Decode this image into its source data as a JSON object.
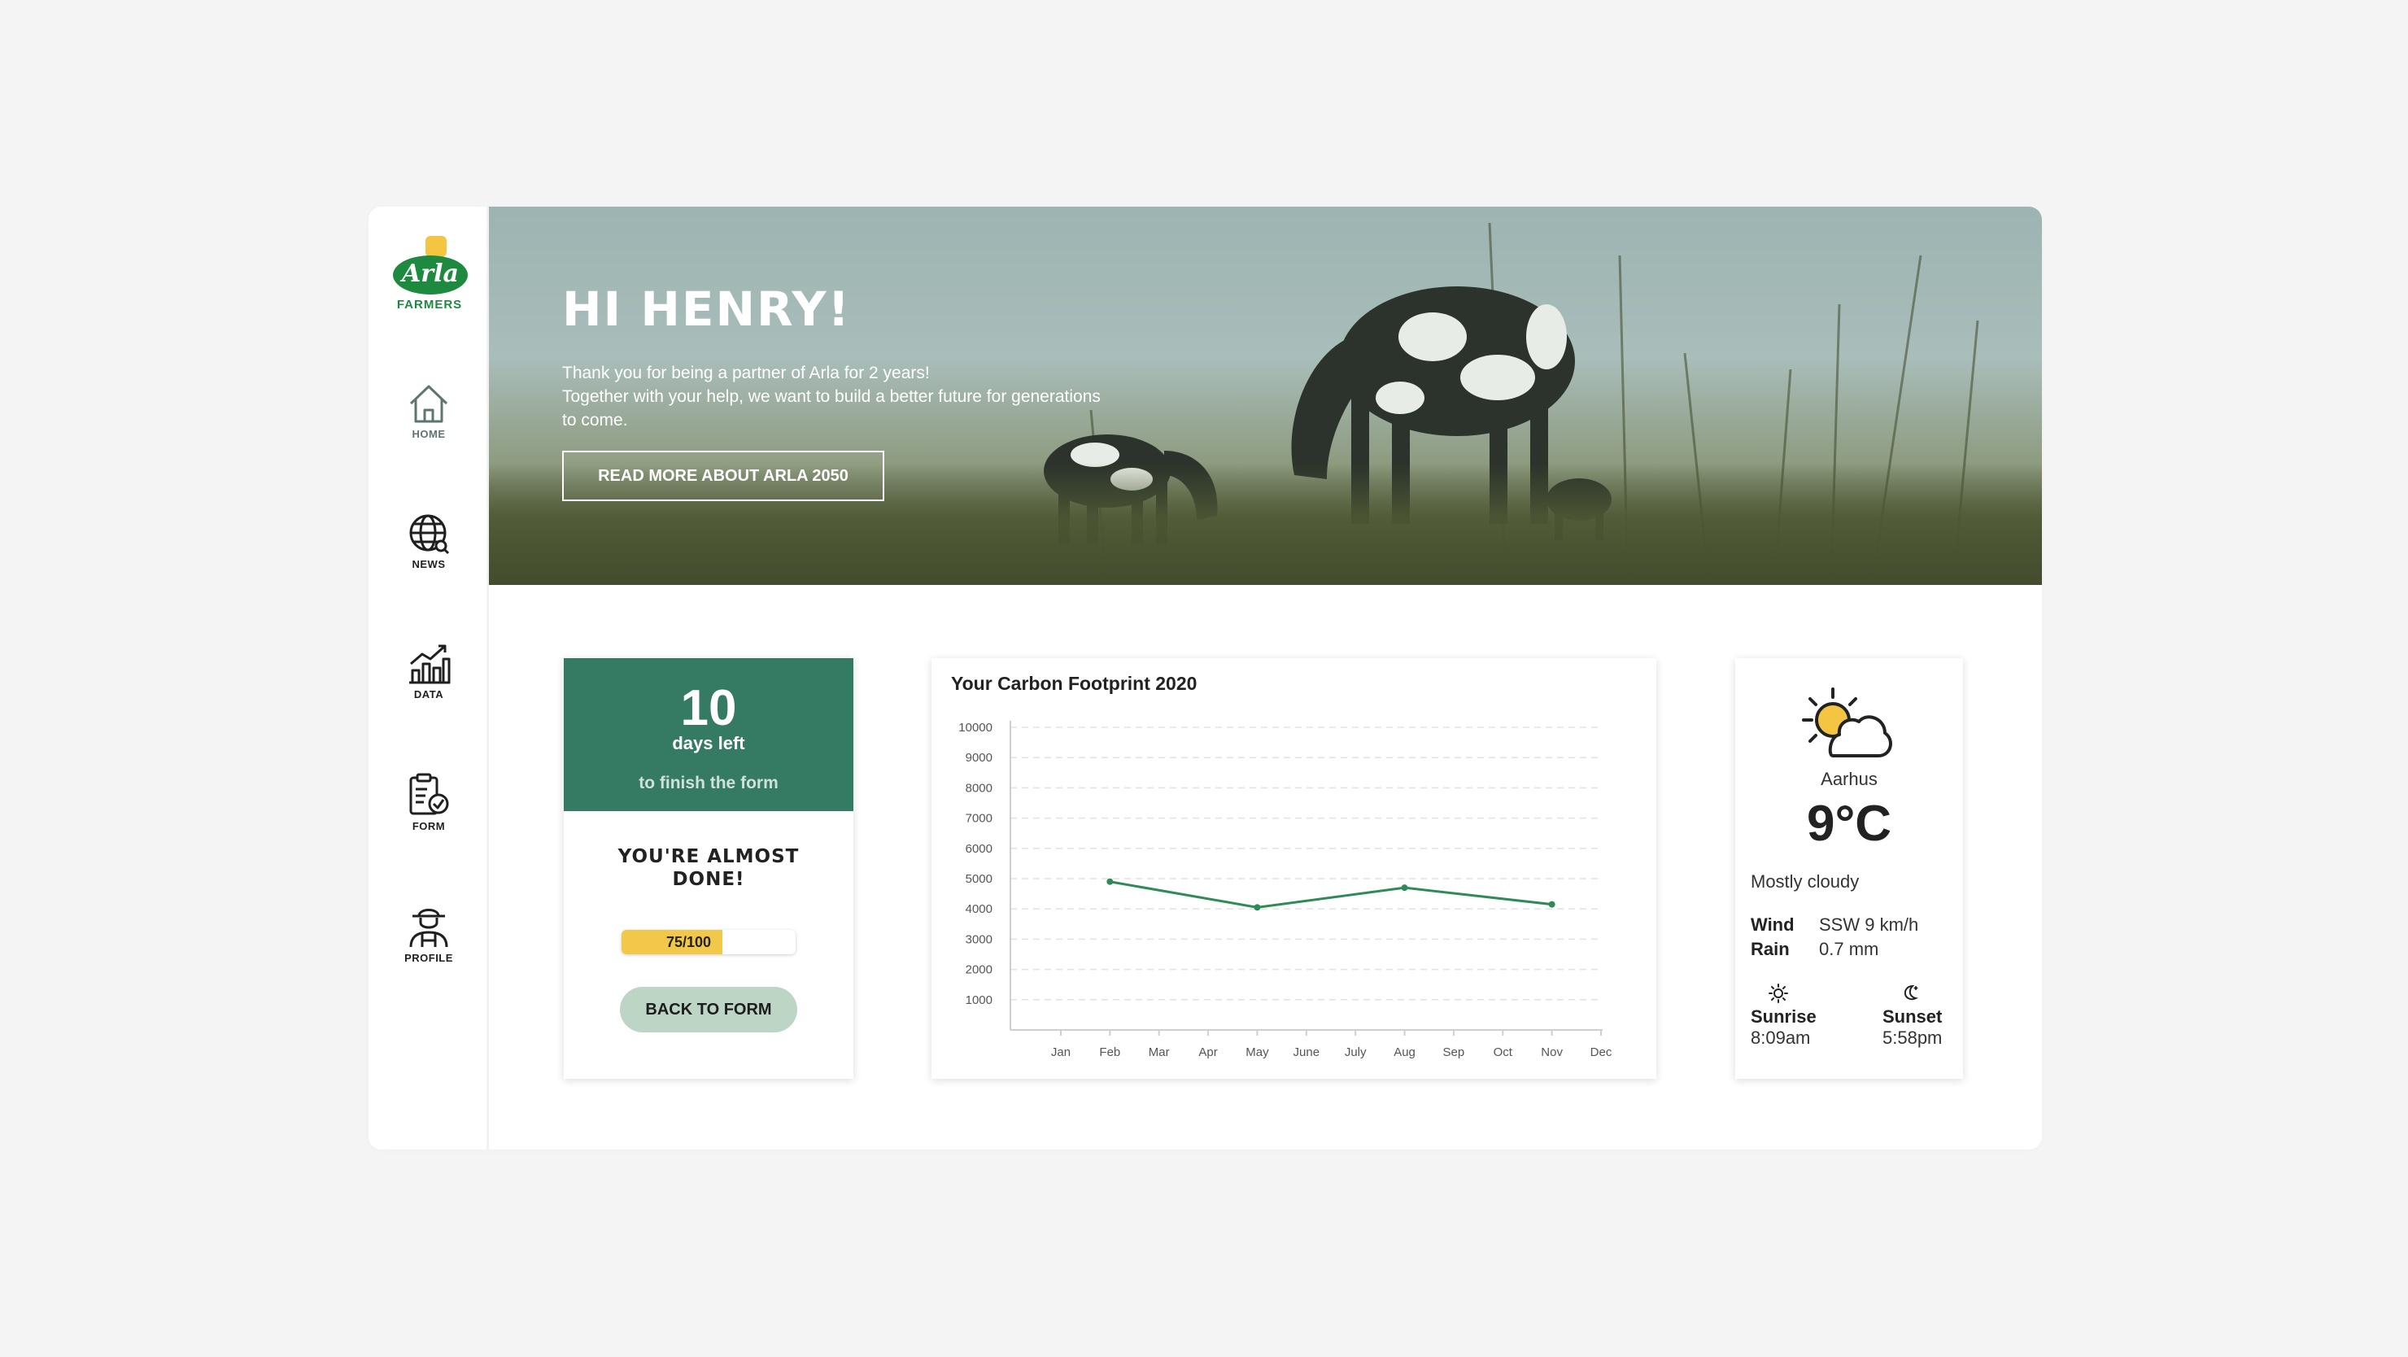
{
  "brand": {
    "logo_text": "Arla",
    "logo_sub": "FARMERS",
    "green": "#1d8a3f"
  },
  "nav": {
    "items": [
      {
        "label": "HOME",
        "icon": "home-icon"
      },
      {
        "label": "NEWS",
        "icon": "globe-icon"
      },
      {
        "label": "DATA",
        "icon": "bar-chart-icon"
      },
      {
        "label": "FORM",
        "icon": "clipboard-check-icon"
      },
      {
        "label": "PROFILE",
        "icon": "farmer-icon"
      }
    ]
  },
  "hero": {
    "greeting": "HI HENRY!",
    "lines": [
      "Thank you for being a partner of Arla for 2 years!",
      "Together with your help, we want to build  a better future for generations",
      "to come."
    ],
    "cta_label": "READ MORE ABOUT ARLA 2050"
  },
  "form_card": {
    "days": "10",
    "days_label": "days left",
    "finish_label": "to finish the form",
    "almost_line1": "YOU'RE ALMOST",
    "almost_line2": "DONE!",
    "progress_text": "75/100",
    "progress_value": 75,
    "progress_max": 100,
    "back_label": "BACK TO FORM",
    "accent": "#357a63",
    "bar_color": "#f2c84b"
  },
  "chart_data": {
    "type": "line",
    "title": "Your Carbon Footprint 2020",
    "categories": [
      "Jan",
      "Feb",
      "Mar",
      "Apr",
      "May",
      "June",
      "July",
      "Aug",
      "Sep",
      "Oct",
      "Nov",
      "Dec"
    ],
    "yticks": [
      1000,
      2000,
      3000,
      4000,
      5000,
      6000,
      7000,
      8000,
      9000,
      10000
    ],
    "ylim": [
      0,
      10000
    ],
    "series": [
      {
        "points": [
          {
            "x": "Feb",
            "y": 4900
          },
          {
            "x": "May",
            "y": 4050
          },
          {
            "x": "Aug",
            "y": 4700
          },
          {
            "x": "Nov",
            "y": 4150
          }
        ],
        "color": "#2e8b57"
      }
    ],
    "grid": true,
    "legend": "none"
  },
  "weather": {
    "icon": "sun-cloud-icon",
    "city": "Aarhus",
    "temp": "9°C",
    "condition": "Mostly cloudy",
    "wind_label": "Wind",
    "wind_value": "SSW 9 km/h",
    "rain_label": "Rain",
    "rain_value": "0.7 mm",
    "sunrise_label": "Sunrise",
    "sunrise_value": "8:09am",
    "sunset_label": "Sunset",
    "sunset_value": "5:58pm"
  }
}
